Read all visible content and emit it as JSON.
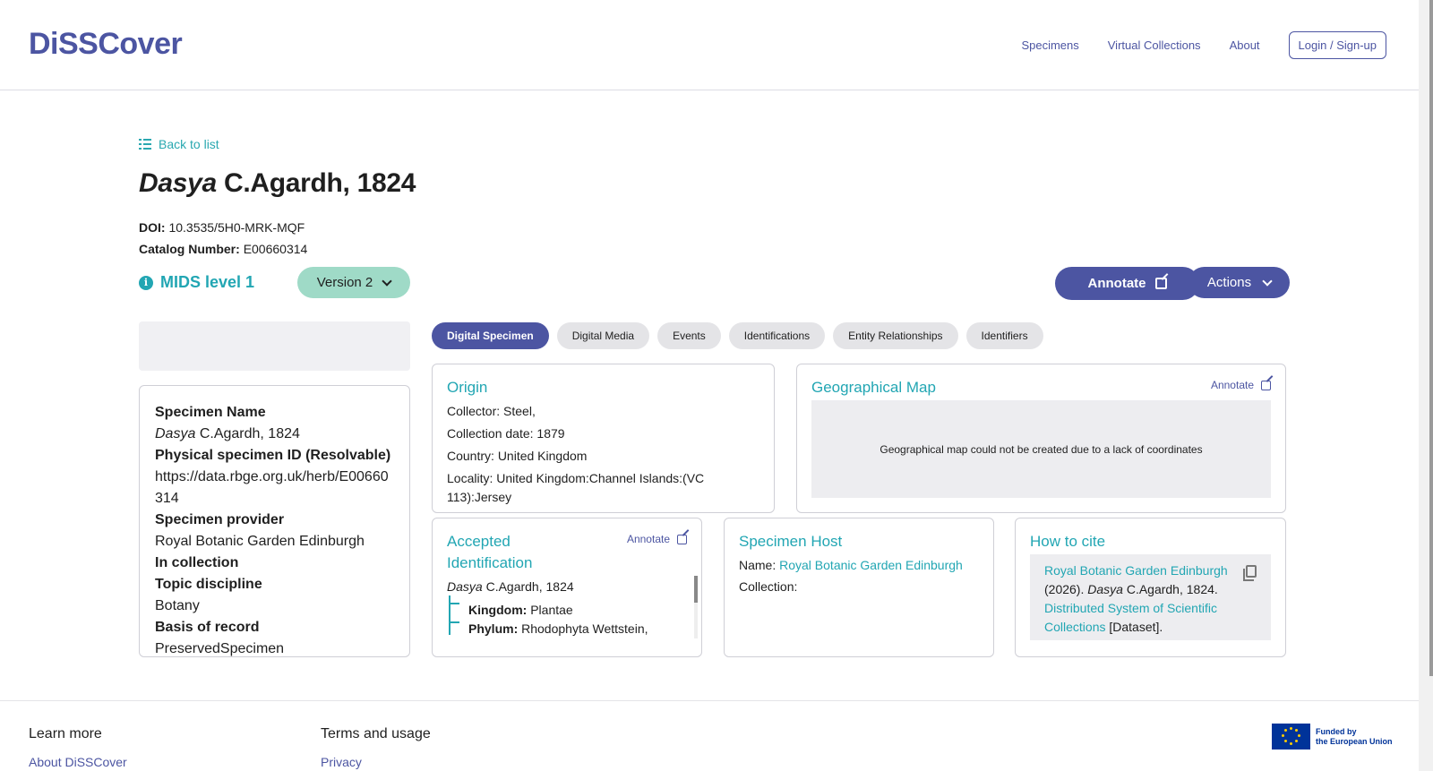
{
  "header": {
    "logo": "DiSSCover",
    "nav": [
      "Specimens",
      "Virtual Collections",
      "About"
    ],
    "login_label": "Login / Sign-up"
  },
  "page": {
    "back_label": "Back to list",
    "title_genus": "Dasya",
    "title_author": "C.Agardh, 1824",
    "doi_label": "DOI:",
    "doi_value": "10.3535/5H0-MRK-MQF",
    "catalog_label": "Catalog Number:",
    "catalog_value": "E00660314",
    "mids_label": "MIDS level 1",
    "version_label": "Version 2",
    "annotate_label": "Annotate",
    "actions_label": "Actions"
  },
  "specimen_summary": [
    {
      "label": "Specimen Name",
      "value_italic": "Dasya",
      "value": "C.Agardh, 1824"
    },
    {
      "label": "Physical specimen ID (Resolvable)",
      "value": "https://data.rbge.org.uk/herb/E00660314"
    },
    {
      "label": "Specimen provider",
      "value": "Royal Botanic Garden Edinburgh"
    },
    {
      "label": "In collection",
      "value": ""
    },
    {
      "label": "Topic discipline",
      "value": "Botany"
    },
    {
      "label": "Basis of record",
      "value": "PreservedSpecimen"
    }
  ],
  "tabs": [
    "Digital Specimen",
    "Digital Media",
    "Events",
    "Identifications",
    "Entity Relationships",
    "Identifiers"
  ],
  "origin": {
    "title": "Origin",
    "rows": [
      {
        "label": "Collector:",
        "value": "Steel,"
      },
      {
        "label": "Collection date:",
        "value": "1879"
      },
      {
        "label": "Country:",
        "value": "United Kingdom"
      },
      {
        "label": "Locality:",
        "value": "United Kingdom:Channel Islands:(VC 113):Jersey"
      }
    ]
  },
  "geo_map": {
    "title": "Geographical Map",
    "annotate_label": "Annotate",
    "message": "Geographical map could not be created due to a lack of coordinates"
  },
  "accepted_identification": {
    "title": "Accepted Identification",
    "annotate_label": "Annotate",
    "name_italic": "Dasya",
    "name_rest": "C.Agardh, 1824",
    "kingdom_label": "Kingdom:",
    "kingdom_value": "Plantae",
    "phylum_label": "Phylum:",
    "phylum_value": "Rhodophyta Wettstein,"
  },
  "specimen_host": {
    "title": "Specimen Host",
    "name_label": "Name:",
    "name_value": "Royal Botanic Garden Edinburgh",
    "collection_label": "Collection:"
  },
  "how_to_cite": {
    "title": "How to cite",
    "link1": "Royal Botanic Garden Edinburgh",
    "text1": "(2026).",
    "italic": "Dasya",
    "text2": "C.Agardh, 1824.",
    "link2": "Distributed System of Scientific Collections",
    "text3": "[Dataset]."
  },
  "footer": {
    "learn_more": "Learn more",
    "about_link": "About DiSSCover",
    "terms": "Terms and usage",
    "privacy": "Privacy",
    "eu_line1": "Funded by",
    "eu_line2": "the European Union"
  },
  "colors": {
    "brand": "#4c55a2",
    "accent": "#22a6b3",
    "version_bg": "#9fdac7"
  }
}
